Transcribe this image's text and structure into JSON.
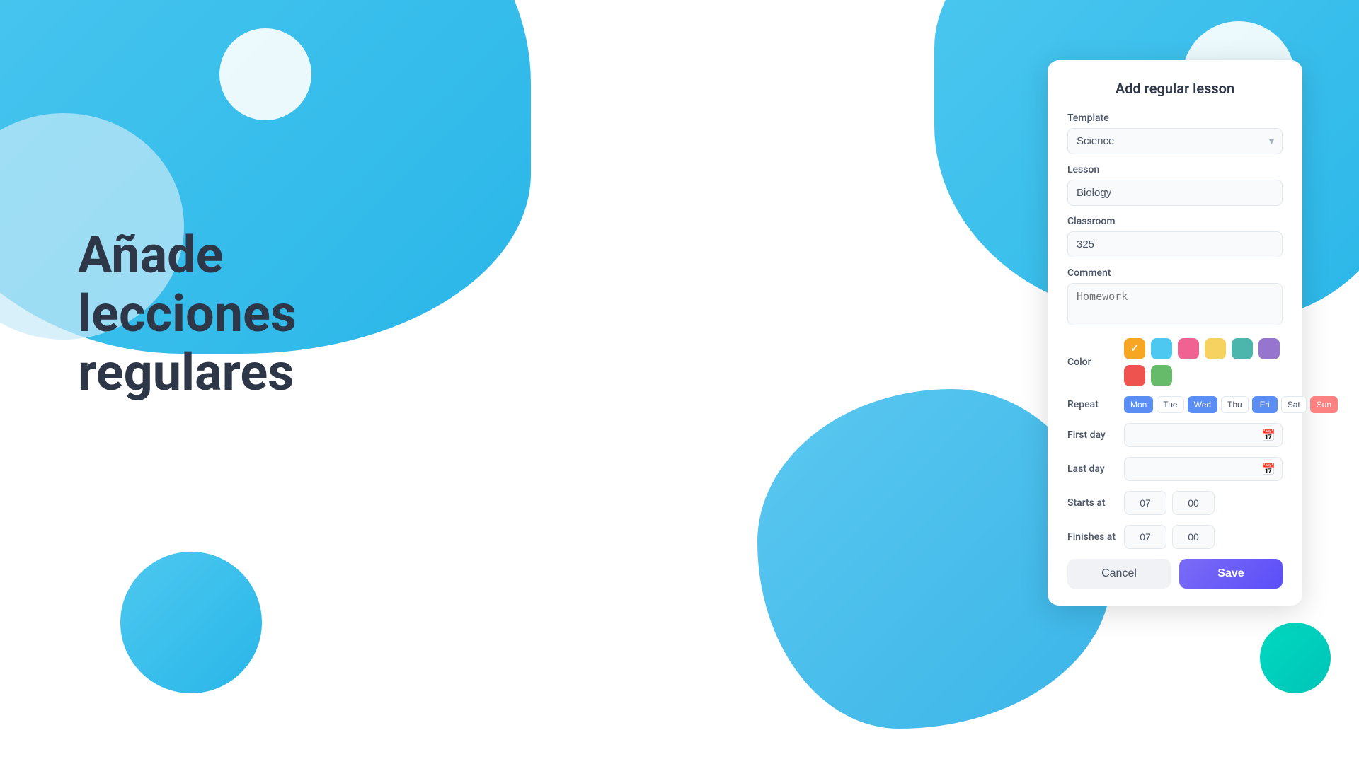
{
  "background": {
    "gradient_start": "#4dc8f0",
    "gradient_end": "#29b6e8"
  },
  "hero": {
    "title": "Añade lecciones regulares"
  },
  "modal": {
    "title": "Add regular lesson",
    "fields": {
      "template_label": "Template",
      "template_value": "Science",
      "template_placeholder": "Science",
      "lesson_label": "Lesson",
      "lesson_value": "Biology",
      "lesson_placeholder": "Biology",
      "classroom_label": "Classroom",
      "classroom_value": "325",
      "classroom_placeholder": "325",
      "comment_label": "Comment",
      "comment_placeholder": "Homework"
    },
    "color": {
      "label": "Color",
      "options": [
        {
          "name": "orange",
          "hex": "#f6a623",
          "selected": true
        },
        {
          "name": "cyan",
          "hex": "#4dc8f0",
          "selected": false
        },
        {
          "name": "pink",
          "hex": "#f06292",
          "selected": false
        },
        {
          "name": "yellow",
          "hex": "#f6d360",
          "selected": false
        },
        {
          "name": "teal",
          "hex": "#4db6ac",
          "selected": false
        },
        {
          "name": "purple",
          "hex": "#9575cd",
          "selected": false
        },
        {
          "name": "red",
          "hex": "#ef5350",
          "selected": false
        },
        {
          "name": "green",
          "hex": "#66bb6a",
          "selected": false
        }
      ]
    },
    "repeat": {
      "label": "Repeat",
      "days": [
        {
          "label": "Mon",
          "active": true,
          "style": "blue"
        },
        {
          "label": "Tue",
          "active": false,
          "style": "none"
        },
        {
          "label": "Wed",
          "active": true,
          "style": "blue"
        },
        {
          "label": "Thu",
          "active": false,
          "style": "none"
        },
        {
          "label": "Fri",
          "active": true,
          "style": "blue"
        },
        {
          "label": "Sat",
          "active": false,
          "style": "none"
        },
        {
          "label": "Sun",
          "active": true,
          "style": "red"
        }
      ]
    },
    "first_day": {
      "label": "First day",
      "value": ""
    },
    "last_day": {
      "label": "Last day",
      "value": ""
    },
    "starts_at": {
      "label": "Starts at",
      "hour": "07",
      "minute": "00"
    },
    "finishes_at": {
      "label": "Finishes at",
      "hour": "07",
      "minute": "00"
    },
    "buttons": {
      "cancel": "Cancel",
      "save": "Save"
    }
  }
}
